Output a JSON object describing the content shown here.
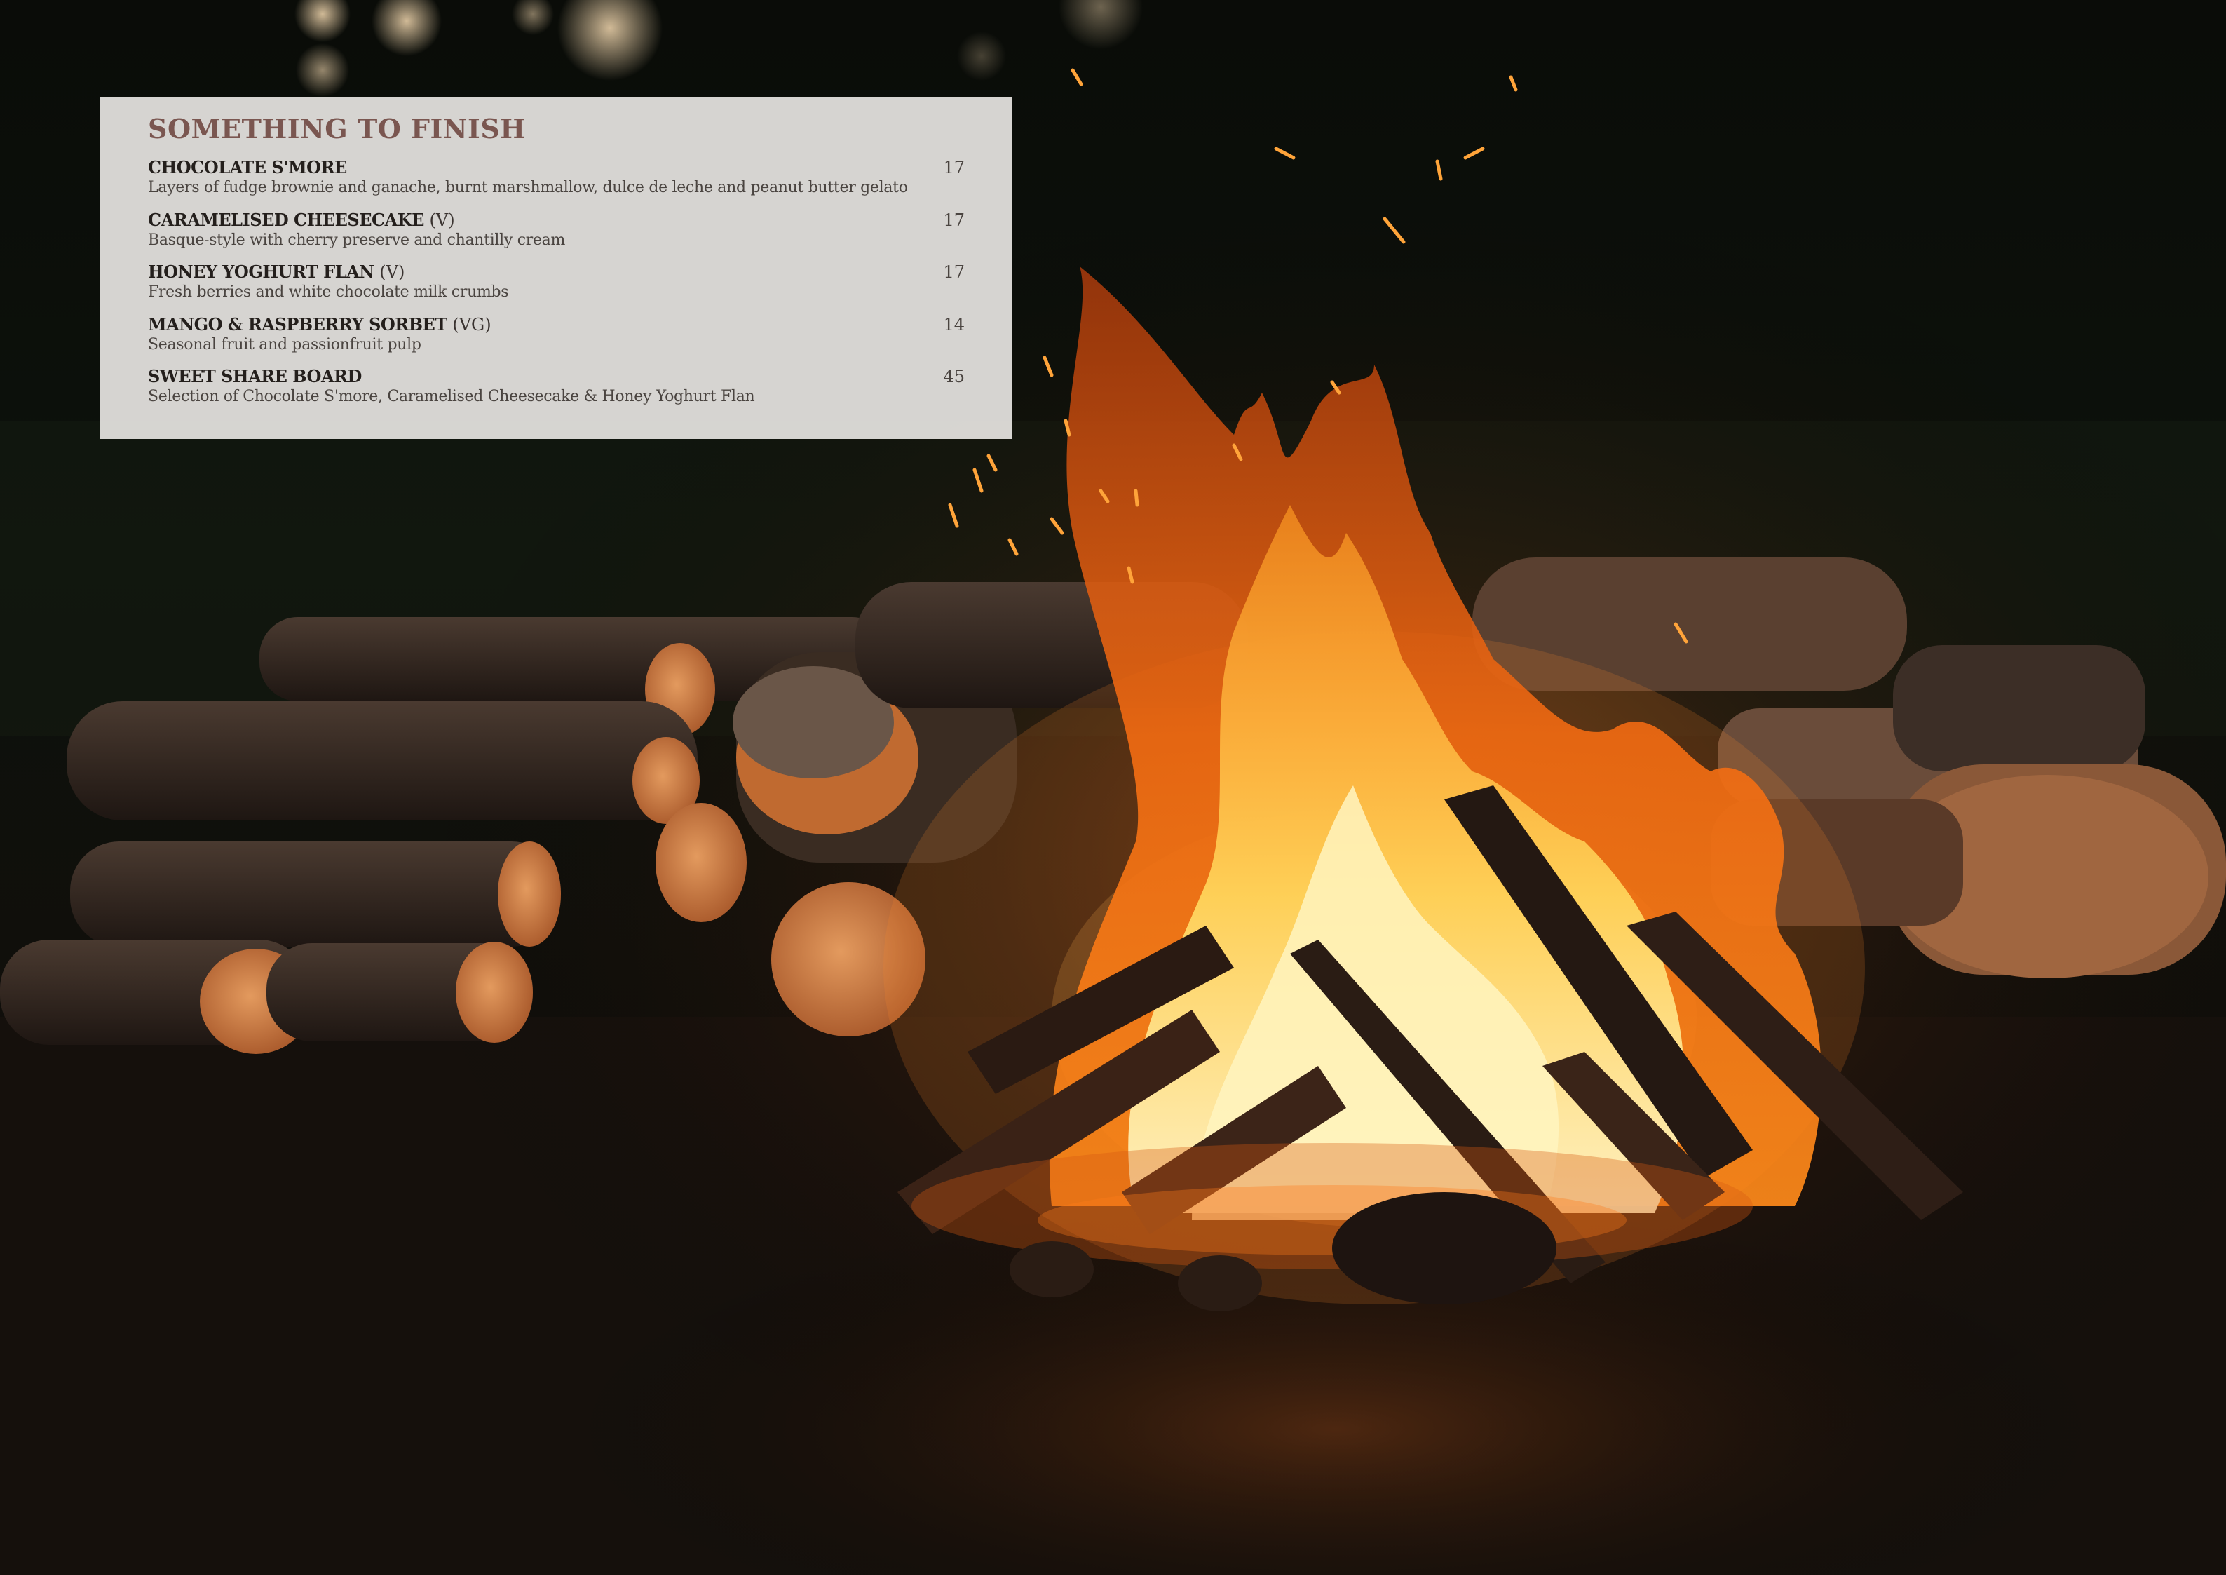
{
  "theme": {
    "title_color": "#7a5650",
    "panel_color": "#e2dfdc"
  },
  "background": {
    "icon": "campfire-photo"
  },
  "menu": {
    "title": "SOMETHING TO FINISH",
    "items": [
      {
        "name": "CHOCOLATE S'MORE",
        "tag": "",
        "description": "Layers of fudge brownie and ganache, burnt marshmallow, dulce de leche and peanut butter gelato",
        "price": "17"
      },
      {
        "name": "CARAMELISED CHEESECAKE",
        "tag": "(V)",
        "description": "Basque-style with cherry preserve and chantilly cream",
        "price": "17"
      },
      {
        "name": "HONEY YOGHURT FLAN",
        "tag": "(V)",
        "description": "Fresh berries and white chocolate milk crumbs",
        "price": "17"
      },
      {
        "name": "MANGO & RASPBERRY SORBET",
        "tag": "(VG)",
        "description": "Seasonal fruit and passionfruit pulp",
        "price": "14"
      },
      {
        "name": "SWEET SHARE BOARD",
        "tag": "",
        "description": "Selection of Chocolate S'more, Caramelised Cheesecake & Honey Yoghurt Flan",
        "price": "45"
      }
    ]
  }
}
